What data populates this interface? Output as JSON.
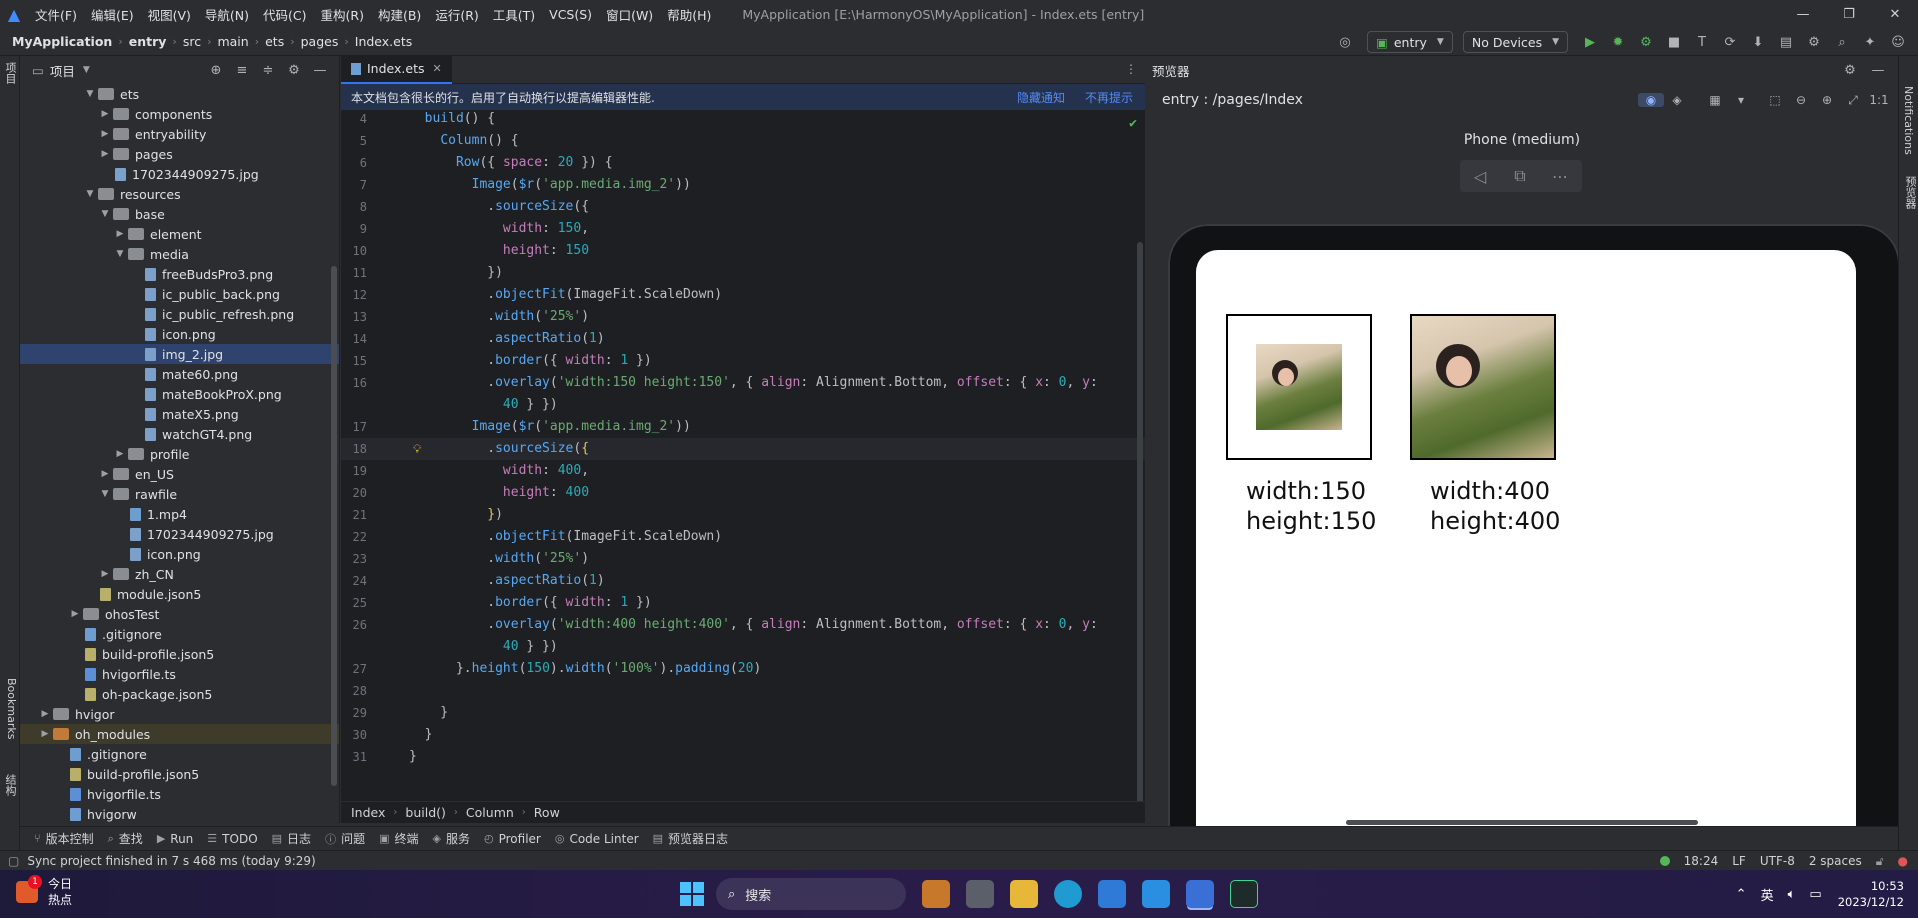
{
  "menubar": {
    "items": [
      "文件(F)",
      "编辑(E)",
      "视图(V)",
      "导航(N)",
      "代码(C)",
      "重构(R)",
      "构建(B)",
      "运行(R)",
      "工具(T)",
      "VCS(S)",
      "窗口(W)",
      "帮助(H)"
    ],
    "window_title": "MyApplication [E:\\HarmonyOS\\MyApplication] - Index.ets [entry]"
  },
  "navbar": {
    "crumbs": [
      "MyApplication",
      "entry",
      "src",
      "main",
      "ets",
      "pages",
      "Index.ets"
    ],
    "module_select": "entry",
    "device_select": "No Devices"
  },
  "left_strip": {
    "project_tab": "项目",
    "bookmarks_tab": "Bookmarks",
    "structure_tab": "结构"
  },
  "project": {
    "title": "项目",
    "tree": [
      {
        "label": "ets",
        "type": "folder",
        "indent": 4,
        "chev": "down"
      },
      {
        "label": "components",
        "type": "folder",
        "indent": 5,
        "chev": "right"
      },
      {
        "label": "entryability",
        "type": "folder",
        "indent": 5,
        "chev": "right"
      },
      {
        "label": "pages",
        "type": "folder",
        "indent": 5,
        "chev": "right"
      },
      {
        "label": "1702344909275.jpg",
        "type": "img",
        "indent": 5,
        "chev": ""
      },
      {
        "label": "resources",
        "type": "folder",
        "indent": 4,
        "chev": "down"
      },
      {
        "label": "base",
        "type": "folder",
        "indent": 5,
        "chev": "down"
      },
      {
        "label": "element",
        "type": "folder",
        "indent": 6,
        "chev": "right"
      },
      {
        "label": "media",
        "type": "folder",
        "indent": 6,
        "chev": "down"
      },
      {
        "label": "freeBudsPro3.png",
        "type": "img",
        "indent": 7,
        "chev": ""
      },
      {
        "label": "ic_public_back.png",
        "type": "img",
        "indent": 7,
        "chev": ""
      },
      {
        "label": "ic_public_refresh.png",
        "type": "img",
        "indent": 7,
        "chev": ""
      },
      {
        "label": "icon.png",
        "type": "img",
        "indent": 7,
        "chev": ""
      },
      {
        "label": "img_2.jpg",
        "type": "img",
        "indent": 7,
        "chev": "",
        "selected": true
      },
      {
        "label": "mate60.png",
        "type": "img",
        "indent": 7,
        "chev": ""
      },
      {
        "label": "mateBookProX.png",
        "type": "img",
        "indent": 7,
        "chev": ""
      },
      {
        "label": "mateX5.png",
        "type": "img",
        "indent": 7,
        "chev": ""
      },
      {
        "label": "watchGT4.png",
        "type": "img",
        "indent": 7,
        "chev": ""
      },
      {
        "label": "profile",
        "type": "folder",
        "indent": 6,
        "chev": "right"
      },
      {
        "label": "en_US",
        "type": "folder",
        "indent": 5,
        "chev": "right"
      },
      {
        "label": "rawfile",
        "type": "folder",
        "indent": 5,
        "chev": "down"
      },
      {
        "label": "1.mp4",
        "type": "file",
        "indent": 6,
        "chev": ""
      },
      {
        "label": "1702344909275.jpg",
        "type": "img",
        "indent": 6,
        "chev": ""
      },
      {
        "label": "icon.png",
        "type": "img",
        "indent": 6,
        "chev": ""
      },
      {
        "label": "zh_CN",
        "type": "folder",
        "indent": 5,
        "chev": "right"
      },
      {
        "label": "module.json5",
        "type": "json",
        "indent": 4,
        "chev": ""
      },
      {
        "label": "ohosTest",
        "type": "folder",
        "indent": 3,
        "chev": "right"
      },
      {
        "label": ".gitignore",
        "type": "file",
        "indent": 3,
        "chev": ""
      },
      {
        "label": "build-profile.json5",
        "type": "json",
        "indent": 3,
        "chev": ""
      },
      {
        "label": "hvigorfile.ts",
        "type": "ts",
        "indent": 3,
        "chev": ""
      },
      {
        "label": "oh-package.json5",
        "type": "json",
        "indent": 3,
        "chev": ""
      },
      {
        "label": "hvigor",
        "type": "folder",
        "indent": 1,
        "chev": "right"
      },
      {
        "label": "oh_modules",
        "type": "folder-orange",
        "indent": 1,
        "chev": "right",
        "highlight": true
      },
      {
        "label": ".gitignore",
        "type": "file",
        "indent": 2,
        "chev": ""
      },
      {
        "label": "build-profile.json5",
        "type": "json",
        "indent": 2,
        "chev": ""
      },
      {
        "label": "hvigorfile.ts",
        "type": "ts",
        "indent": 2,
        "chev": ""
      },
      {
        "label": "hvigorw",
        "type": "file",
        "indent": 2,
        "chev": ""
      }
    ]
  },
  "editor": {
    "tab_label": "Index.ets",
    "notice_text": "本文档包含很长的行。启用了自动换行以提高编辑器性能.",
    "notice_hide": "隐藏通知",
    "notice_never": "不再提示",
    "breadcrumbs": [
      "Index",
      "build()",
      "Column",
      "Row"
    ],
    "lines": [
      {
        "n": "4",
        "html": "  <span class='f'>build</span>() {"
      },
      {
        "n": "5",
        "html": "    <span class='f'>Column</span>() {"
      },
      {
        "n": "6",
        "html": "      <span class='f'>Row</span>({ <span class='p'>space</span>: <span class='n'>20</span> }) {"
      },
      {
        "n": "7",
        "html": "        <span class='f'>Image</span>(<span class='f'>$r</span>(<span class='s'>'app.media.img_2'</span>))"
      },
      {
        "n": "8",
        "html": "          .<span class='f'>sourceSize</span>({"
      },
      {
        "n": "9",
        "html": "            <span class='p'>width</span>: <span class='n'>150</span>,"
      },
      {
        "n": "10",
        "html": "            <span class='p'>height</span>: <span class='n'>150</span>"
      },
      {
        "n": "11",
        "html": "          })"
      },
      {
        "n": "12",
        "html": "          .<span class='f'>objectFit</span>(ImageFit.ScaleDown)"
      },
      {
        "n": "13",
        "html": "          .<span class='f'>width</span>(<span class='s'>'25%'</span>)"
      },
      {
        "n": "14",
        "html": "          .<span class='f'>aspectRatio</span>(<span class='n'>1</span>)"
      },
      {
        "n": "15",
        "html": "          .<span class='f'>border</span>({ <span class='p'>width</span>: <span class='n'>1</span> })"
      },
      {
        "n": "16",
        "html": "          .<span class='f'>overlay</span>(<span class='s'>'width:150 height:150'</span>, { <span class='p'>align</span>: Alignment.Bottom, <span class='p'>offset</span>: { <span class='p'>x</span>: <span class='n'>0</span>, <span class='p'>y</span>:"
      },
      {
        "n": "",
        "html": "            <span class='n'>40</span> } })"
      },
      {
        "n": "17",
        "html": "        <span class='f'>Image</span>(<span class='f'>$r</span>(<span class='s'>'app.media.img_2'</span>))"
      },
      {
        "n": "18",
        "html": "          .<span class='f'>sourceSize</span>(<span class='y'>{</span>",
        "current": true
      },
      {
        "n": "19",
        "html": "            <span class='p'>width</span>: <span class='n'>400</span>,"
      },
      {
        "n": "20",
        "html": "            <span class='p'>height</span>: <span class='n'>400</span>"
      },
      {
        "n": "21",
        "html": "          <span class='y'>}</span>)"
      },
      {
        "n": "22",
        "html": "          .<span class='f'>objectFit</span>(ImageFit.ScaleDown)"
      },
      {
        "n": "23",
        "html": "          .<span class='f'>width</span>(<span class='s'>'25%'</span>)"
      },
      {
        "n": "24",
        "html": "          .<span class='f'>aspectRatio</span>(<span class='n'>1</span>)"
      },
      {
        "n": "25",
        "html": "          .<span class='f'>border</span>({ <span class='p'>width</span>: <span class='n'>1</span> })"
      },
      {
        "n": "26",
        "html": "          .<span class='f'>overlay</span>(<span class='s'>'width:400 height:400'</span>, { <span class='p'>align</span>: Alignment.Bottom, <span class='p'>offset</span>: { <span class='p'>x</span>: <span class='n'>0</span>, <span class='p'>y</span>:"
      },
      {
        "n": "",
        "html": "            <span class='n'>40</span> } })"
      },
      {
        "n": "27",
        "html": "      }.<span class='f'>height</span>(<span class='n'>150</span>).<span class='f'>width</span>(<span class='s'>'100%'</span>).<span class='f'>padding</span>(<span class='n'>20</span>)"
      },
      {
        "n": "28",
        "html": ""
      },
      {
        "n": "29",
        "html": "    }"
      },
      {
        "n": "30",
        "html": "  }"
      },
      {
        "n": "31",
        "html": "}"
      }
    ]
  },
  "preview": {
    "title": "预览器",
    "route": "entry : /pages/Index",
    "device_name": "Phone (medium)",
    "overlay_1_line1": "width:150",
    "overlay_1_line2": "height:150",
    "overlay_2_line1": "width:400",
    "overlay_2_line2": "height:400"
  },
  "right_strip": {
    "notifications_tab": "Notifications",
    "previewer_tab": "预览器"
  },
  "tool_windows": [
    "版本控制",
    "查找",
    "Run",
    "TODO",
    "日志",
    "问题",
    "终端",
    "服务",
    "Profiler",
    "Code Linter",
    "预览器日志"
  ],
  "status": {
    "message": "Sync project finished in 7 s 468 ms (today 9:29)",
    "position": "18:24",
    "line_sep": "LF",
    "encoding": "UTF-8",
    "indent": "2 spaces"
  },
  "taskbar": {
    "news_line1": "今日",
    "news_line2": "热点",
    "news_badge": "1",
    "search_placeholder": "搜索",
    "ime": "英",
    "time": "10:53",
    "date": "2023/12/12"
  }
}
